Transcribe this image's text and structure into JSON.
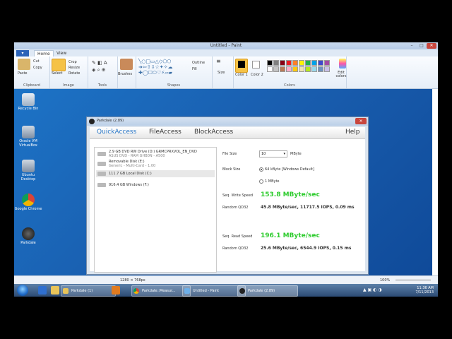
{
  "paint": {
    "title": "Untitled - Paint",
    "tabs": [
      "Home",
      "View"
    ],
    "groups": {
      "clipboard": {
        "label": "Clipboard",
        "paste": "Paste",
        "cut": "Cut",
        "copy": "Copy"
      },
      "image": {
        "label": "Image",
        "select": "Select",
        "crop": "Crop",
        "resize": "Resize",
        "rotate": "Rotate"
      },
      "tools": {
        "label": "Tools"
      },
      "brushes": {
        "label": "Brushes"
      },
      "shapes": {
        "label": "Shapes",
        "outline": "Outline",
        "fill": "Fill"
      },
      "size": {
        "label": "Size"
      },
      "colors": {
        "label": "Colors",
        "color1": "Color 1",
        "color2": "Color 2",
        "edit": "Edit colors"
      }
    },
    "palette": [
      "#000000",
      "#7f7f7f",
      "#880015",
      "#ed1c24",
      "#ff7f27",
      "#fff200",
      "#22b14c",
      "#00a2e8",
      "#3f48cc",
      "#a349a4",
      "#ffffff",
      "#c3c3c3",
      "#b97a57",
      "#ffaec9",
      "#ffc90e",
      "#efe4b0",
      "#b5e61d",
      "#99d9ea",
      "#7092be",
      "#c8bfe7"
    ],
    "status": {
      "dimensions": "1280 × 768px",
      "zoom": "100%"
    }
  },
  "desktop_icons": [
    {
      "label": "Recycle Bin",
      "name": "recycle-bin-icon"
    },
    {
      "label": "Oracle VM VirtualBox",
      "name": "virtualbox-icon"
    },
    {
      "label": "Ubuntu Desktop",
      "name": "ubuntu-desktop-icon"
    },
    {
      "label": "Google Chrome",
      "name": "chrome-icon"
    },
    {
      "label": "Parkdale",
      "name": "parkdale-icon"
    }
  ],
  "parkdale": {
    "title": "Parkdale (2.89)",
    "nav": {
      "quick": "QuickAccess",
      "file": "FileAccess",
      "block": "BlockAccess",
      "help": "Help"
    },
    "drives": [
      {
        "line1": "2.9 GB DVD RW Drive (D:) GRMCPRXVOL_EN_DVD",
        "line2": "ASUS DVD - RAM GHB0N - A500"
      },
      {
        "line1": "Removable Disk (E:)",
        "line2": "Generic - Multi-Card - 1.00"
      },
      {
        "line1": "111.7 GB Local Disk (C:)",
        "line2": ""
      },
      {
        "line1": "916.4 GB Windows (F:)",
        "line2": ""
      }
    ],
    "file_size_label": "File Size",
    "file_size_value": "10",
    "file_size_unit": "MByte",
    "block_size_label": "Block Size",
    "block_opt1": "64 kByte [Windows Default]",
    "block_opt2": "1 MByte",
    "seq_write_label": "Seq. Write Speed",
    "seq_write_value": "153.8 MByte/sec",
    "rand_write_label": "Random QD32",
    "rand_write_value": "45.8 MByte/sec, 11717.5 IOPS, 0.09 ms",
    "seq_read_label": "Seq. Read Speed",
    "seq_read_value": "196.1 MByte/sec",
    "rand_read_label": "Random QD32",
    "rand_read_value": "25.6 MByte/sec, 6544.9 IOPS, 0.15 ms"
  },
  "taskbar": {
    "items": [
      "Parkdale (1)",
      "Parkdale::Measur...",
      "Untitled - Paint",
      "Parkdale (2.89)"
    ],
    "time": "11:36 AM",
    "date": "7/11/2013"
  },
  "colors": {
    "accent_blue": "#2a78c8",
    "speed_green": "#2ecc2e"
  }
}
